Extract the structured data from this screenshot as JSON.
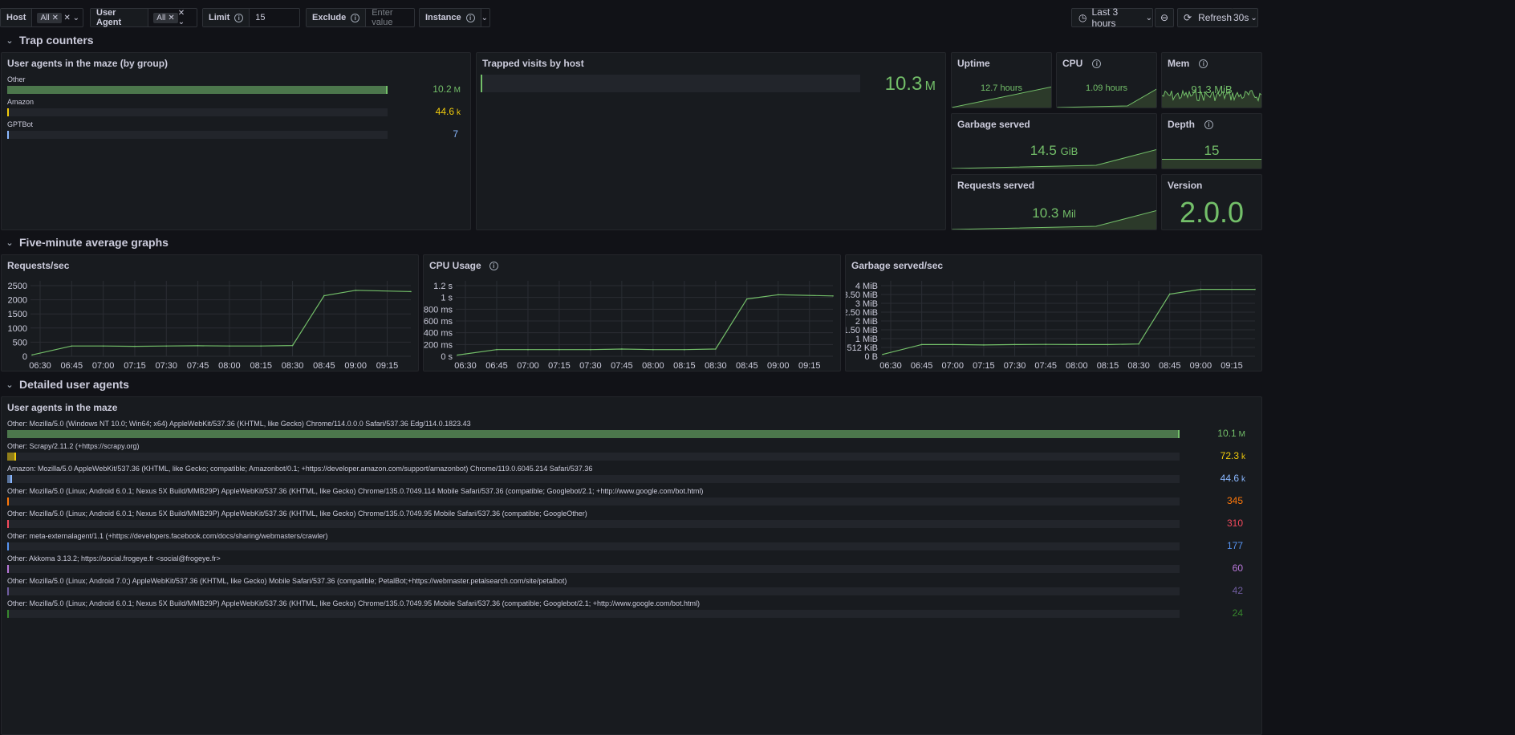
{
  "toolbar": {
    "host_label": "Host",
    "host_value": "All",
    "ua_label": "User Agent",
    "ua_value": "All",
    "limit_label": "Limit",
    "limit_value": "15",
    "exclude_label": "Exclude",
    "exclude_placeholder": "Enter value",
    "instance_label": "Instance",
    "time_range": "Last 3 hours",
    "refresh_label": "Refresh",
    "refresh_interval": "30s"
  },
  "rows": {
    "trap": "Trap counters",
    "five": "Five-minute average graphs",
    "detailed": "Detailed user agents"
  },
  "panels": {
    "ua_group": {
      "title": "User agents in the maze (by group)",
      "items": [
        {
          "label": "Other",
          "value": "10.2",
          "unit": "M",
          "fraction": 1.0,
          "color": "#73bf69"
        },
        {
          "label": "Amazon",
          "value": "44.6",
          "unit": "k",
          "fraction": 0.0044,
          "color": "#f2cc0c"
        },
        {
          "label": "GPTBot",
          "value": "7",
          "unit": "",
          "fraction": 0.0,
          "color": "#8ab8ff"
        }
      ]
    },
    "trapped": {
      "title": "Trapped visits by host",
      "value": "10.3",
      "unit": "M"
    },
    "uptime": {
      "title": "Uptime",
      "value": "12.7 hours"
    },
    "cpu": {
      "title": "CPU",
      "value": "1.09 hours"
    },
    "mem": {
      "title": "Mem",
      "value": "91.3 MiB"
    },
    "garbage": {
      "title": "Garbage served",
      "value": "14.5",
      "unit": "GiB"
    },
    "depth": {
      "title": "Depth",
      "value": "15"
    },
    "requests": {
      "title": "Requests served",
      "value": "10.3",
      "unit": "Mil"
    },
    "version": {
      "title": "Version",
      "value": "2.0.0"
    },
    "detail": {
      "title": "User agents in the maze",
      "items": [
        {
          "label": "Other: Mozilla/5.0 (Windows NT 10.0; Win64; x64) AppleWebKit/537.36 (KHTML, like Gecko) Chrome/114.0.0.0 Safari/537.36 Edg/114.0.1823.43",
          "value": "10.1",
          "unit": "M",
          "fraction": 1.0,
          "color": "#73bf69"
        },
        {
          "label": "Other: Scrapy/2.11.2 (+https://scrapy.org)",
          "value": "72.3",
          "unit": "k",
          "fraction": 0.0072,
          "color": "#f2cc0c"
        },
        {
          "label": "Amazon: Mozilla/5.0 AppleWebKit/537.36 (KHTML, like Gecko; compatible; Amazonbot/0.1; +https://developer.amazon.com/support/amazonbot) Chrome/119.0.6045.214 Safari/537.36",
          "value": "44.6",
          "unit": "k",
          "fraction": 0.0044,
          "color": "#8ab8ff"
        },
        {
          "label": "Other: Mozilla/5.0 (Linux; Android 6.0.1; Nexus 5X Build/MMB29P) AppleWebKit/537.36 (KHTML, like Gecko) Chrome/135.0.7049.114 Mobile Safari/537.36 (compatible; Googlebot/2.1; +http://www.google.com/bot.html)",
          "value": "345",
          "unit": "",
          "fraction": 0.0,
          "color": "#ff780a"
        },
        {
          "label": "Other: Mozilla/5.0 (Linux; Android 6.0.1; Nexus 5X Build/MMB29P) AppleWebKit/537.36 (KHTML, like Gecko) Chrome/135.0.7049.95 Mobile Safari/537.36 (compatible; GoogleOther)",
          "value": "310",
          "unit": "",
          "fraction": 0.0,
          "color": "#f2495c"
        },
        {
          "label": "Other: meta-externalagent/1.1 (+https://developers.facebook.com/docs/sharing/webmasters/crawler)",
          "value": "177",
          "unit": "",
          "fraction": 0.0,
          "color": "#5794f2"
        },
        {
          "label": "Other: Akkoma 3.13.2; https://social.frogeye.fr <social@frogeye.fr>",
          "value": "60",
          "unit": "",
          "fraction": 0.0,
          "color": "#b877d9"
        },
        {
          "label": "Other: Mozilla/5.0 (Linux; Android 7.0;) AppleWebKit/537.36 (KHTML, like Gecko) Mobile Safari/537.36 (compatible; PetalBot;+https://webmaster.petalsearch.com/site/petalbot)",
          "value": "42",
          "unit": "",
          "fraction": 0.0,
          "color": "#705da0"
        },
        {
          "label": "Other: Mozilla/5.0 (Linux; Android 6.0.1; Nexus 5X Build/MMB29P) AppleWebKit/537.36 (KHTML, like Gecko) Chrome/135.0.7049.95 Mobile Safari/537.36 (compatible; Googlebot/2.1; +http://www.google.com/bot.html)",
          "value": "24",
          "unit": "",
          "fraction": 0.0,
          "color": "#37872d"
        }
      ]
    }
  },
  "chart_data": [
    {
      "type": "line",
      "title": "Requests/sec",
      "x": [
        "06:30",
        "06:45",
        "07:00",
        "07:15",
        "07:30",
        "07:45",
        "08:00",
        "08:15",
        "08:30",
        "08:45",
        "09:00",
        "09:15"
      ],
      "y_ticks": [
        "0",
        "500",
        "1000",
        "1500",
        "2000",
        "2500"
      ],
      "ylim": [
        0,
        2800
      ],
      "series": [
        {
          "values": [
            50,
            380,
            380,
            370,
            380,
            390,
            380,
            380,
            400,
            2250,
            2450,
            2400
          ]
        }
      ],
      "color": "#73bf69"
    },
    {
      "type": "line",
      "title": "CPU Usage",
      "x": [
        "06:30",
        "06:45",
        "07:00",
        "07:15",
        "07:30",
        "07:45",
        "08:00",
        "08:15",
        "08:30",
        "08:45",
        "09:00",
        "09:15"
      ],
      "y_ticks": [
        "0 s",
        "200 ms",
        "400 ms",
        "600 ms",
        "800 ms",
        "1 s",
        "1.2 s"
      ],
      "ylim": [
        0,
        1.25
      ],
      "series": [
        {
          "values": [
            0.02,
            0.11,
            0.11,
            0.11,
            0.11,
            0.12,
            0.11,
            0.11,
            0.12,
            0.95,
            1.02,
            1.0
          ]
        }
      ],
      "color": "#73bf69"
    },
    {
      "type": "line",
      "title": "Garbage served/sec",
      "x": [
        "06:30",
        "06:45",
        "07:00",
        "07:15",
        "07:30",
        "07:45",
        "08:00",
        "08:15",
        "08:30",
        "08:45",
        "09:00",
        "09:15"
      ],
      "y_ticks": [
        "0 B",
        "512 KiB",
        "1 MiB",
        "1.50 MiB",
        "2 MiB",
        "2.50 MiB",
        "3 MiB",
        "3.50 MiB",
        "4 MiB"
      ],
      "ylim": [
        0,
        4
      ],
      "series": [
        {
          "values": [
            0.1,
            0.62,
            0.62,
            0.6,
            0.62,
            0.63,
            0.62,
            0.62,
            0.65,
            3.3,
            3.55,
            3.55
          ]
        }
      ],
      "color": "#73bf69"
    }
  ]
}
